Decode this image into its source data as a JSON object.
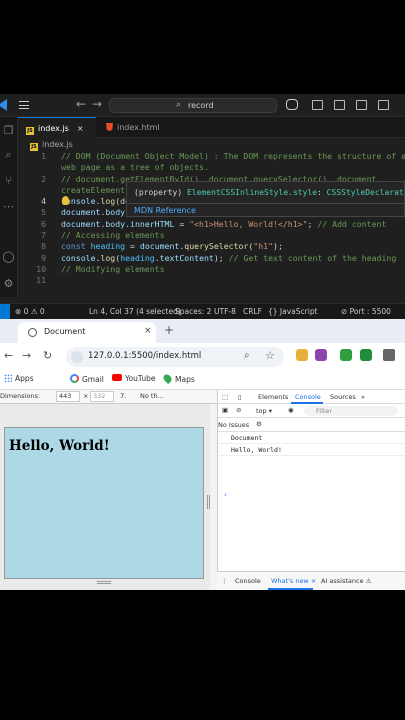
{
  "vscode": {
    "search_placeholder": "record",
    "tabs": [
      {
        "label": "index.js",
        "close": "×"
      },
      {
        "label": "index.html"
      }
    ],
    "breadcrumb": "index.js",
    "lines": [
      {
        "num": "1",
        "segments": [
          {
            "t": "// DOM (Document Object Model) : The DOM represents the structure of a",
            "c": "c-com"
          }
        ]
      },
      {
        "num": "",
        "segments": [
          {
            "t": "web page as a tree of objects.",
            "c": "c-com"
          }
        ]
      },
      {
        "num": "2",
        "segments": [
          {
            "t": "// document.getElementById(), document.querySelector(), document.",
            "c": "c-com"
          }
        ]
      },
      {
        "num": "",
        "segments": [
          {
            "t": "createElement(",
            "c": "c-com"
          }
        ]
      },
      {
        "num": "4",
        "segments": [
          {
            "t": "console",
            "c": "c-var"
          },
          {
            "t": ".",
            "c": "c-plain"
          },
          {
            "t": "log",
            "c": "c-fn"
          },
          {
            "t": "(do",
            "c": "c-plain"
          }
        ]
      },
      {
        "num": "5",
        "segments": [
          {
            "t": "document",
            "c": "c-var"
          },
          {
            "t": ".",
            "c": "c-plain"
          },
          {
            "t": "body",
            "c": "c-var"
          },
          {
            "t": ".",
            "c": "c-plain"
          },
          {
            "t": "style",
            "c": "c-var"
          },
          {
            "t": ".",
            "c": "c-plain"
          },
          {
            "t": "backgroundColor",
            "c": "c-var"
          },
          {
            "t": " = ",
            "c": "c-plain"
          },
          {
            "t": "\"lightblue\"",
            "c": "c-str"
          },
          {
            "t": "; ",
            "c": "c-plain"
          },
          {
            "t": "// Change background",
            "c": "c-com"
          }
        ]
      },
      {
        "num": "6",
        "segments": [
          {
            "t": "document",
            "c": "c-var"
          },
          {
            "t": ".",
            "c": "c-plain"
          },
          {
            "t": "body",
            "c": "c-var"
          },
          {
            "t": ".",
            "c": "c-plain"
          },
          {
            "t": "innerHTML",
            "c": "c-var"
          },
          {
            "t": " = ",
            "c": "c-plain"
          },
          {
            "t": "\"<h1>Hello, World!</h1>\"",
            "c": "c-str"
          },
          {
            "t": "; ",
            "c": "c-plain"
          },
          {
            "t": "// Add content",
            "c": "c-com"
          }
        ]
      },
      {
        "num": "7",
        "segments": [
          {
            "t": "// Accessing elements",
            "c": "c-com"
          }
        ]
      },
      {
        "num": "8",
        "segments": [
          {
            "t": "const",
            "c": "c-kw"
          },
          {
            "t": " ",
            "c": "c-plain"
          },
          {
            "t": "heading",
            "c": "c-var2"
          },
          {
            "t": " = ",
            "c": "c-plain"
          },
          {
            "t": "document",
            "c": "c-var"
          },
          {
            "t": ".",
            "c": "c-plain"
          },
          {
            "t": "querySelector",
            "c": "c-fn"
          },
          {
            "t": "(",
            "c": "c-plain"
          },
          {
            "t": "\"h1\"",
            "c": "c-str"
          },
          {
            "t": ");",
            "c": "c-plain"
          }
        ]
      },
      {
        "num": "9",
        "segments": [
          {
            "t": "console",
            "c": "c-var"
          },
          {
            "t": ".",
            "c": "c-plain"
          },
          {
            "t": "log",
            "c": "c-fn"
          },
          {
            "t": "(",
            "c": "c-plain"
          },
          {
            "t": "heading",
            "c": "c-var2"
          },
          {
            "t": ".",
            "c": "c-plain"
          },
          {
            "t": "textContent",
            "c": "c-var"
          },
          {
            "t": "); ",
            "c": "c-plain"
          },
          {
            "t": "// Get text content of the heading",
            "c": "c-com"
          }
        ]
      },
      {
        "num": "10",
        "segments": [
          {
            "t": "// Modifying elements",
            "c": "c-com"
          }
        ]
      },
      {
        "num": "11",
        "segments": []
      }
    ],
    "hover": {
      "prefix": "(property) ",
      "name": "ElementCSSInlineStyle.style",
      "colon": ": ",
      "type": "CSSStyleDeclaration",
      "link": "MDN Reference"
    },
    "status": {
      "errors": "⊗ 0 ⚠ 0",
      "position": "Ln 4, Col 37 (4 selected)",
      "spaces": "Spaces: 2",
      "encoding": "UTF-8",
      "eol": "CRLF",
      "language": "{} JavaScript",
      "port": "⊘ Port : 5500"
    }
  },
  "browser": {
    "tab_title": "Document",
    "tab_close": "×",
    "new_tab": "+",
    "url": "127.0.0.1:5500/index.html",
    "bookmarks": [
      "Apps",
      "Gmail",
      "YouTube",
      "Maps"
    ],
    "device_toolbar": {
      "dimensions": "Dimensions: ",
      "width": "443",
      "times": "×",
      "height": "332",
      "zoom": "7.",
      "throttle": "No th..."
    },
    "page_heading": "Hello, World!",
    "devtools": {
      "tabs": [
        "Elements",
        "Console",
        "Sources"
      ],
      "context": "top ▾",
      "filter_placeholder": "Filter",
      "issues": "No Issues",
      "log_lines": [
        "Document",
        "Hello, World!"
      ],
      "prompt": "›",
      "drawer_tabs": [
        "Console",
        "What's new ×",
        "AI assistance ⚠"
      ]
    }
  }
}
